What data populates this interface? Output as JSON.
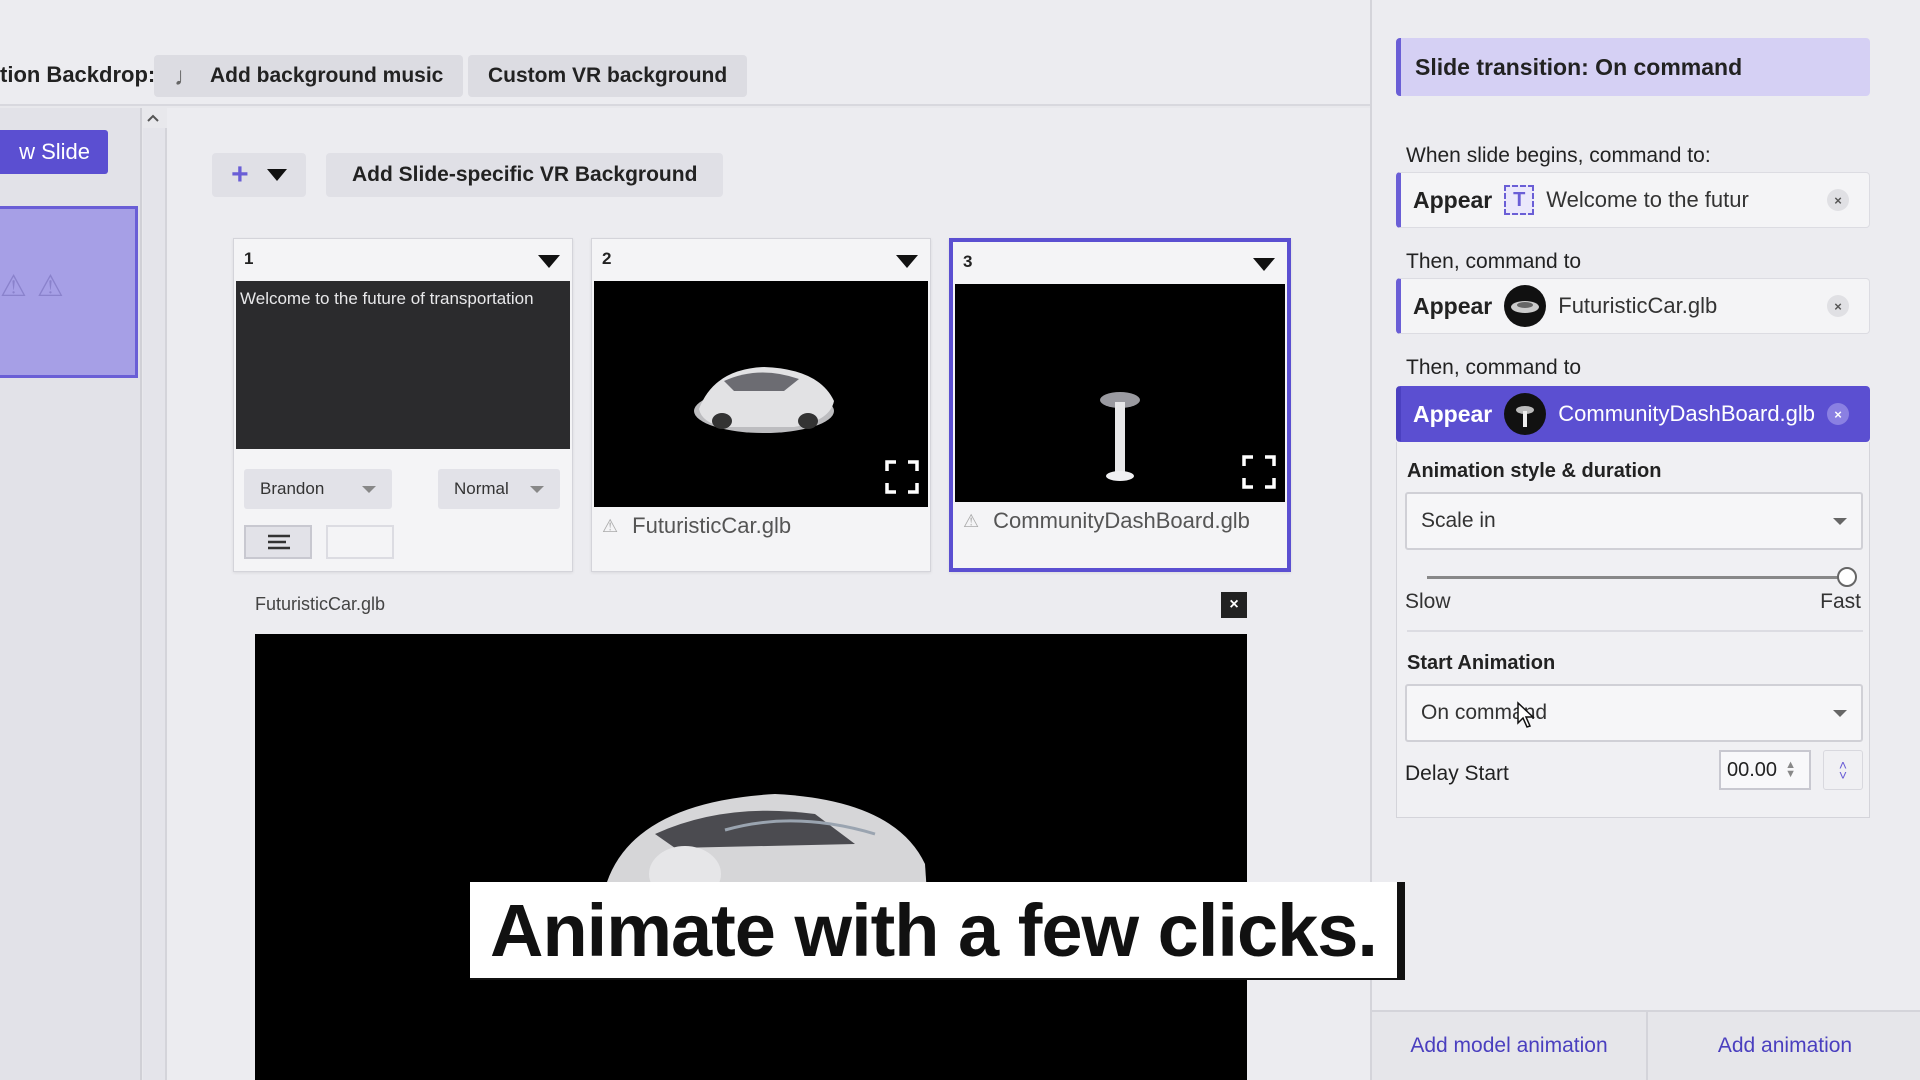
{
  "topbar": {
    "backdrop_label": "tion Backdrop:",
    "music_button": "Add background music",
    "vr_button": "Custom VR background"
  },
  "left": {
    "new_slide_label": "w Slide"
  },
  "toolbar": {
    "add_vr_background": "Add Slide-specific VR Background"
  },
  "slides": [
    {
      "number": "1",
      "text_preview": "Welcome to the future of transportation",
      "font": "Brandon",
      "weight": "Normal"
    },
    {
      "number": "2",
      "file": "FuturisticCar.glb"
    },
    {
      "number": "3",
      "file": "CommunityDashBoard.glb"
    }
  ],
  "viewer": {
    "title": "FuturisticCar.glb",
    "close": "×"
  },
  "panel": {
    "transition": "Slide transition: On command",
    "when_begins": "When slide begins, command to:",
    "then1": "Then, command to",
    "then2": "Then, command to",
    "commands": [
      {
        "verb": "Appear",
        "target": "Welcome to the futur",
        "icon": "text-icon"
      },
      {
        "verb": "Appear",
        "target": "FuturisticCar.glb",
        "icon": "car-model-icon"
      },
      {
        "verb": "Appear",
        "target": "CommunityDashBoard.glb",
        "icon": "dashboard-model-icon"
      }
    ],
    "remove": "×",
    "anim_style_heading": "Animation style & duration",
    "anim_style_value": "Scale in",
    "speed_slow": "Slow",
    "speed_fast": "Fast",
    "speed_value": 1.0,
    "start_heading": "Start Animation",
    "start_value": "On command",
    "delay_label": "Delay Start",
    "delay_value": "00.00",
    "add_model_animation": "Add model animation",
    "add_animation": "Add animation"
  },
  "caption": "Animate with a few clicks.",
  "colors": {
    "accent": "#5b4fd1",
    "accent_light": "#d5d0f4"
  }
}
